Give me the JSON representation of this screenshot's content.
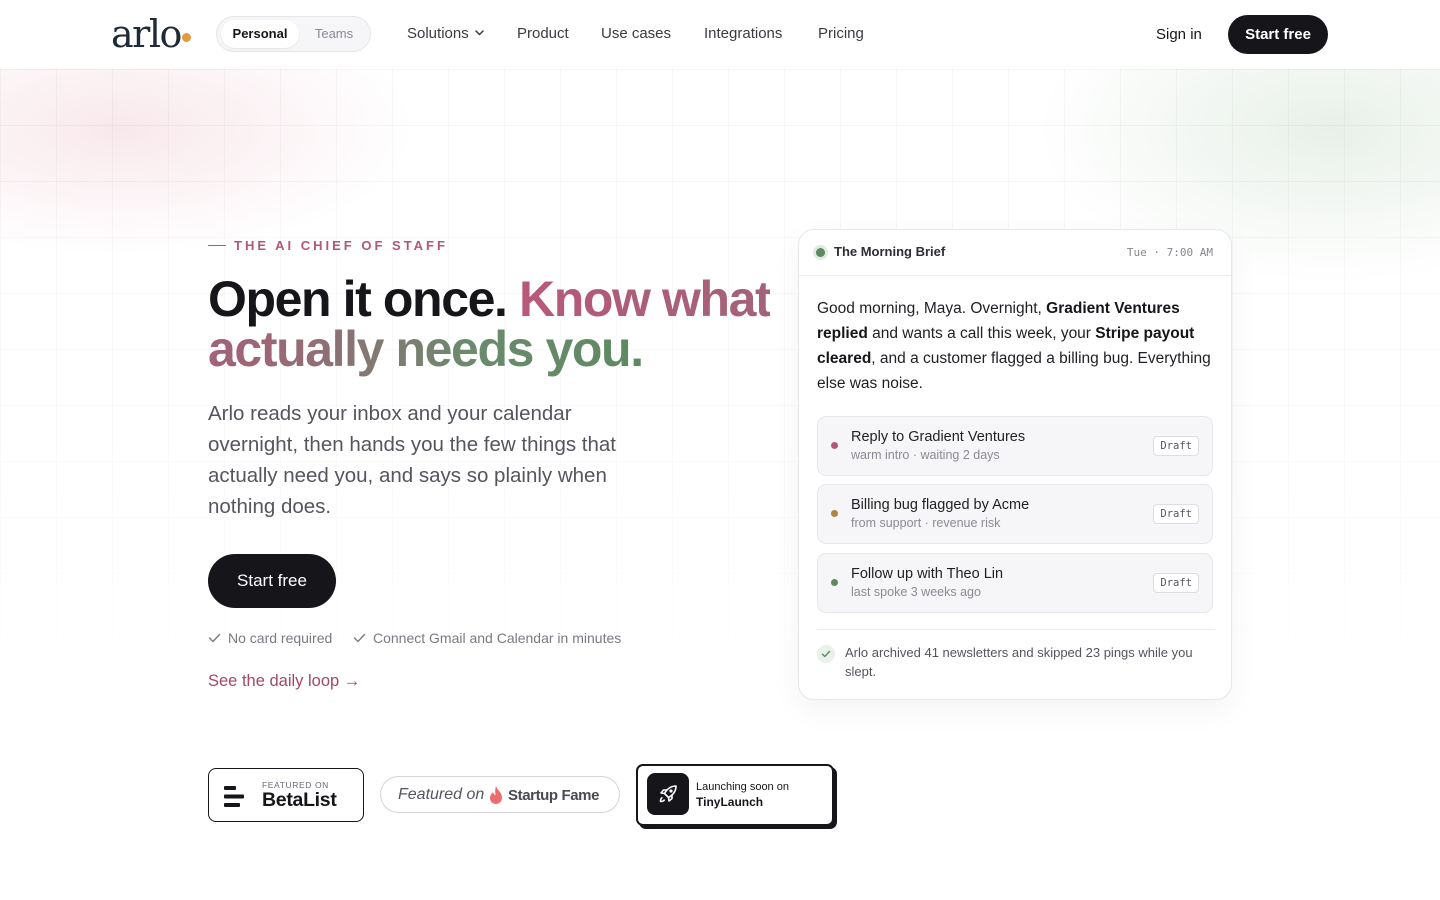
{
  "nav": {
    "logo": "arlo",
    "segment": [
      "Personal",
      "Teams"
    ],
    "links": [
      "Solutions",
      "Product",
      "Use cases",
      "Integrations",
      "Pricing"
    ],
    "sign_in": "Sign in",
    "cta": "Start free"
  },
  "hero": {
    "eyebrow": "THE AI CHIEF OF STAFF",
    "headline_plain": "Open it once.",
    "headline_accent": "Know what actually needs you.",
    "subtitle": "Arlo reads your inbox and your calendar overnight, then hands you the few things that actually need you, and says so plainly when nothing does.",
    "cta": "Start free",
    "perks": [
      "No card required",
      "Connect Gmail and Calendar in minutes"
    ],
    "secondary_link": "See the daily loop",
    "secondary_arrow": "→"
  },
  "brief": {
    "title": "The Morning Brief",
    "time": "Tue · 7:00 AM",
    "text": {
      "p1": "Good morning, Maya. Overnight, ",
      "b1": "Gradient Ventures replied",
      "p2": " and wants a call this week, your ",
      "b2": "Stripe payout cleared",
      "p3": ", and a customer flagged a billing bug. Everything else was noise."
    },
    "items": [
      {
        "title": "Reply to Gradient Ventures",
        "meta": "warm intro · waiting 2 days",
        "tag": "Draft",
        "color": "#b25778"
      },
      {
        "title": "Billing bug flagged by Acme",
        "meta": "from support · revenue risk",
        "tag": "Draft",
        "color": "#b5833a"
      },
      {
        "title": "Follow up with Theo Lin",
        "meta": "last spoke 3 weeks ago",
        "tag": "Draft",
        "color": "#5d8a60"
      }
    ],
    "footnote": "Arlo archived 41 newsletters and skipped 23 pings while you slept."
  },
  "badges": {
    "betalist": {
      "small": "FEATURED ON",
      "big": "BetaList"
    },
    "startupfame": {
      "featured": "Featured on",
      "name": "Startup Fame"
    },
    "tinylaunch": {
      "small": "Launching soon on",
      "big": "TinyLaunch"
    }
  },
  "colors": {
    "accent": "#b25778",
    "green": "#5d8a60",
    "dark": "#16161a"
  }
}
